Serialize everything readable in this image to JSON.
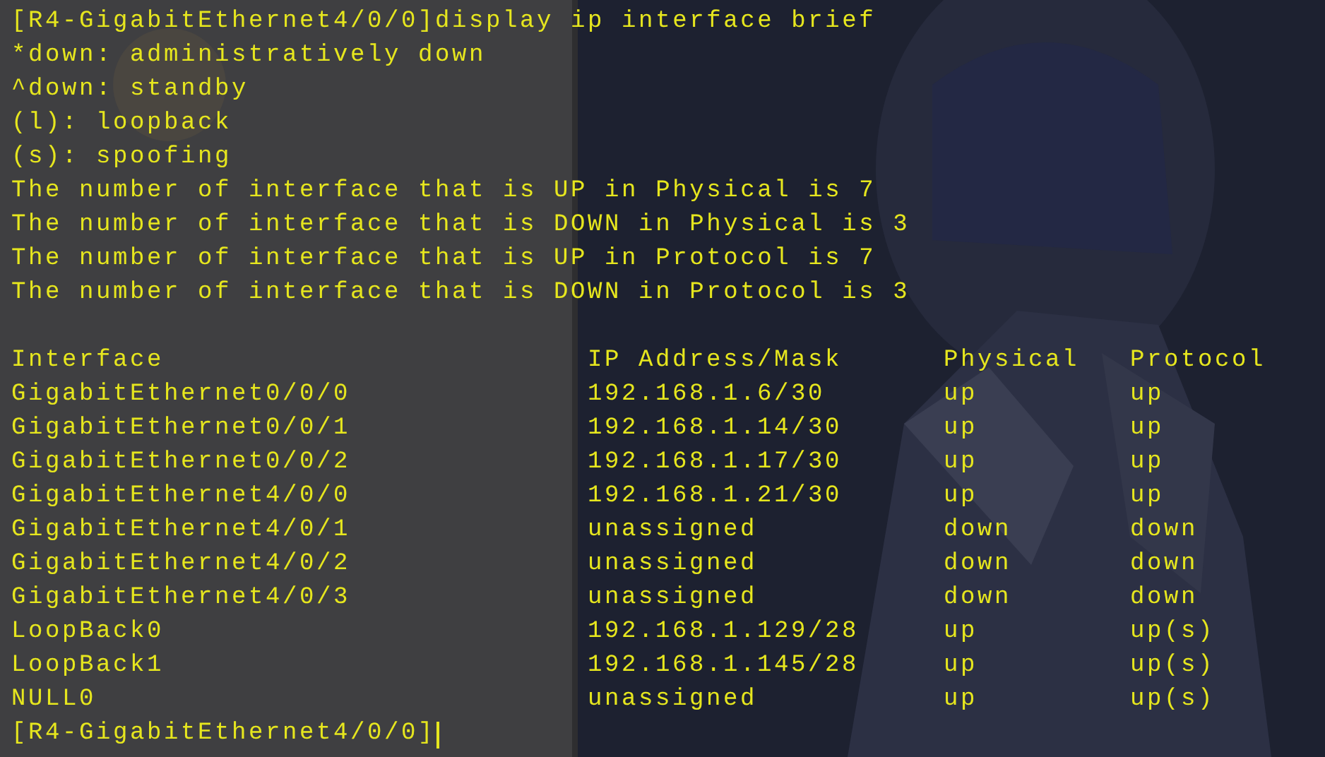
{
  "terminal": {
    "lines": [
      "[R4-GigabitEthernet4/0/0]display ip interface brief",
      "*down: administratively down",
      "^down: standby",
      "(l): loopback",
      "(s): spoofing",
      "The number of interface that is UP in Physical is 7",
      "The number of interface that is DOWN in Physical is 3",
      "The number of interface that is UP in Protocol is 7",
      "The number of interface that is DOWN in Protocol is 3"
    ],
    "table": {
      "columns": [
        "Interface",
        "IP Address/Mask",
        "Physical",
        "Protocol"
      ],
      "rows": [
        [
          "GigabitEthernet0/0/0",
          "192.168.1.6/30",
          "up",
          "up"
        ],
        [
          "GigabitEthernet0/0/1",
          "192.168.1.14/30",
          "up",
          "up"
        ],
        [
          "GigabitEthernet0/0/2",
          "192.168.1.17/30",
          "up",
          "up"
        ],
        [
          "GigabitEthernet4/0/0",
          "192.168.1.21/30",
          "up",
          "up"
        ],
        [
          "GigabitEthernet4/0/1",
          "unassigned",
          "down",
          "down"
        ],
        [
          "GigabitEthernet4/0/2",
          "unassigned",
          "down",
          "down"
        ],
        [
          "GigabitEthernet4/0/3",
          "unassigned",
          "down",
          "down"
        ],
        [
          "LoopBack0",
          "192.168.1.129/28",
          "up",
          "up(s)"
        ],
        [
          "LoopBack1",
          "192.168.1.145/28",
          "up",
          "up(s)"
        ],
        [
          "NULL0",
          "unassigned",
          "up",
          "up(s)"
        ]
      ]
    },
    "prompt": "[R4-GigabitEthernet4/0/0]"
  }
}
